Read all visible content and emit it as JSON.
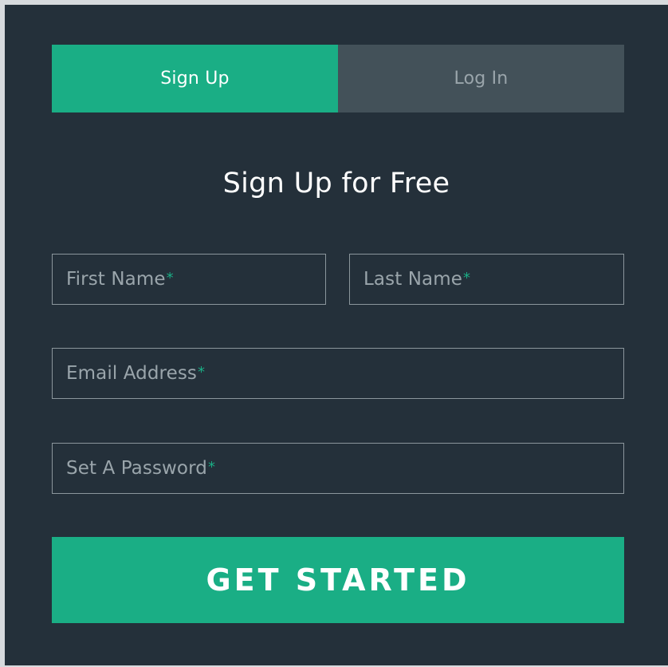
{
  "tabs": {
    "signup_label": "Sign Up",
    "login_label": "Log In"
  },
  "form": {
    "title": "Sign Up for Free",
    "first_name_placeholder": "First Name",
    "last_name_placeholder": "Last Name",
    "email_placeholder": "Email Address",
    "password_placeholder": "Set A Password",
    "required_marker": "*",
    "submit_label": "GET STARTED"
  },
  "colors": {
    "accent": "#1aae85",
    "background": "#24303a",
    "inactive_tab": "#435159",
    "border": "#8b969c",
    "muted_text": "#9aa5ab"
  }
}
